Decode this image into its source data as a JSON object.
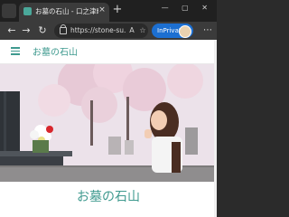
{
  "browser": {
    "tab_title": "お墓の石山 - 口之津町の墓石・石材",
    "tab_close": "×",
    "new_tab": "+",
    "window_controls": "— ▢ ✕",
    "url": "https://stone-su...",
    "inprivate_label": "InPrivate",
    "menu": "⋯"
  },
  "site": {
    "logo": "お墓の石山",
    "page_title": "お墓の石山"
  },
  "colors": {
    "brand": "#3f9a8f",
    "inprivate": "#1c6fd1"
  }
}
